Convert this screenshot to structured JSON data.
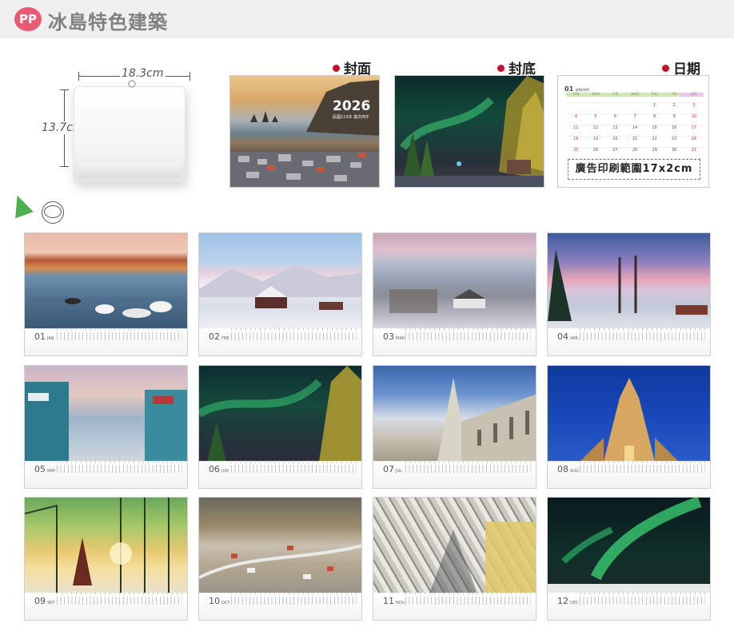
{
  "header": {
    "badge": "PP",
    "title": "冰島特色建築"
  },
  "size": {
    "width_label": "18.3cm",
    "height_label": "13.7cm"
  },
  "pages": {
    "cover_label": "封面",
    "back_label": "封底",
    "date_label": "日期",
    "cover_year": "2026",
    "cover_sub": "民國115年 歲次丙午"
  },
  "date_page": {
    "month": "01",
    "month_name": "JANUARY",
    "weekdays": [
      "SUN",
      "MON",
      "TUE",
      "WED",
      "THU",
      "FRI",
      "SAT"
    ],
    "weeks": [
      [
        "",
        "",
        "",
        "",
        "1",
        "2",
        "3"
      ],
      [
        "4",
        "5",
        "6",
        "7",
        "8",
        "9",
        "10"
      ],
      [
        "11",
        "12",
        "13",
        "14",
        "15",
        "16",
        "17"
      ],
      [
        "18",
        "19",
        "20",
        "21",
        "22",
        "23",
        "24"
      ],
      [
        "25",
        "26",
        "27",
        "28",
        "29",
        "30",
        "31"
      ]
    ],
    "ad_area": "廣告印刷範圍17x2cm"
  },
  "months": [
    {
      "num": "01",
      "name": "JAN"
    },
    {
      "num": "02",
      "name": "FEB"
    },
    {
      "num": "03",
      "name": "MAR"
    },
    {
      "num": "04",
      "name": "APR"
    },
    {
      "num": "05",
      "name": "MAY"
    },
    {
      "num": "06",
      "name": "JUN"
    },
    {
      "num": "07",
      "name": "JUL"
    },
    {
      "num": "08",
      "name": "AUG"
    },
    {
      "num": "09",
      "name": "SEP"
    },
    {
      "num": "10",
      "name": "OCT"
    },
    {
      "num": "11",
      "name": "NOV"
    },
    {
      "num": "12",
      "name": "DEC"
    }
  ],
  "colors": {
    "accent_dot": "#c8102e",
    "badge": "#e85b73"
  }
}
